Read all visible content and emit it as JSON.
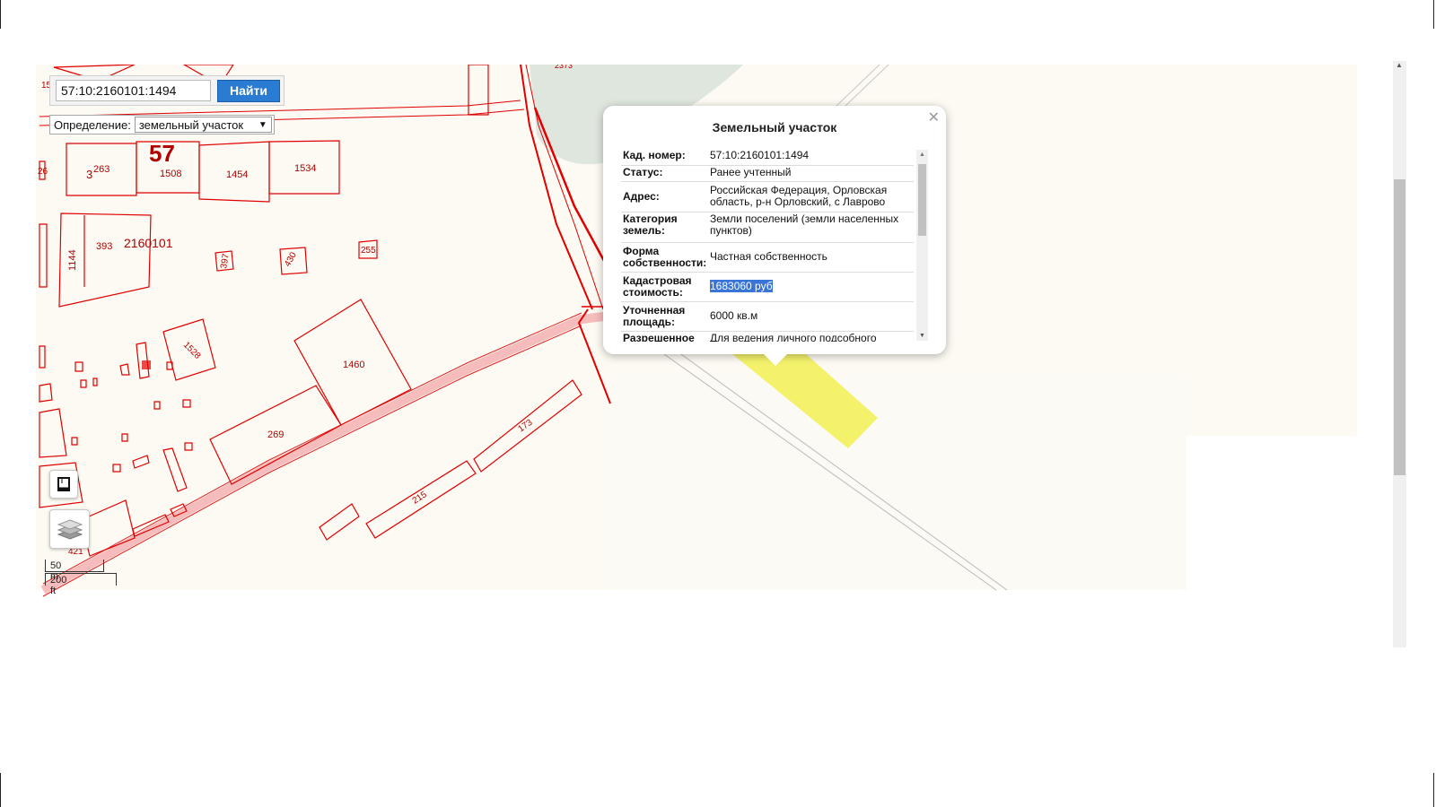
{
  "search": {
    "value": "57:10:2160101:1494",
    "button_label": "Найти"
  },
  "definition": {
    "label": "Определение:",
    "selected": "земельный участок"
  },
  "scale": {
    "metric": "50 m",
    "imperial": "200 ft"
  },
  "popup": {
    "title": "Земельный участок",
    "rows": [
      {
        "key": "Кад. номер:",
        "value": "57:10:2160101:1494"
      },
      {
        "key": "Статус:",
        "value": "Ранее учтенный"
      },
      {
        "key": "Адрес:",
        "value": "Российская Федерация, Орловская область, р-н Орловский, с Лаврово"
      },
      {
        "key": "Категория земель:",
        "value": "Земли поселений (земли населенных пунктов)"
      },
      {
        "key": "Форма собственности:",
        "value": "Частная собственность"
      },
      {
        "key": "Кадастровая стоимость:",
        "value": "1683060 руб"
      },
      {
        "key": "Уточненная площадь:",
        "value": "6000 кв.м"
      },
      {
        "key": "Разрешенное",
        "value": "Для ведения личного подсобного"
      }
    ]
  },
  "map_labels": {
    "block_number": "57",
    "quarter": "2160101",
    "parcels": [
      "263",
      "1508",
      "1454",
      "1534",
      "393",
      "1144",
      "397",
      "430",
      "255",
      "1528",
      "1460",
      "269",
      "173",
      "215",
      "421",
      "3",
      "26",
      "15",
      "2373"
    ]
  },
  "colors": {
    "parcel": "#e00000",
    "map_bg": "#fcfaf2",
    "road": "#f6bcbc",
    "highlight": "#f4f26b",
    "button": "#2a7bd2"
  }
}
